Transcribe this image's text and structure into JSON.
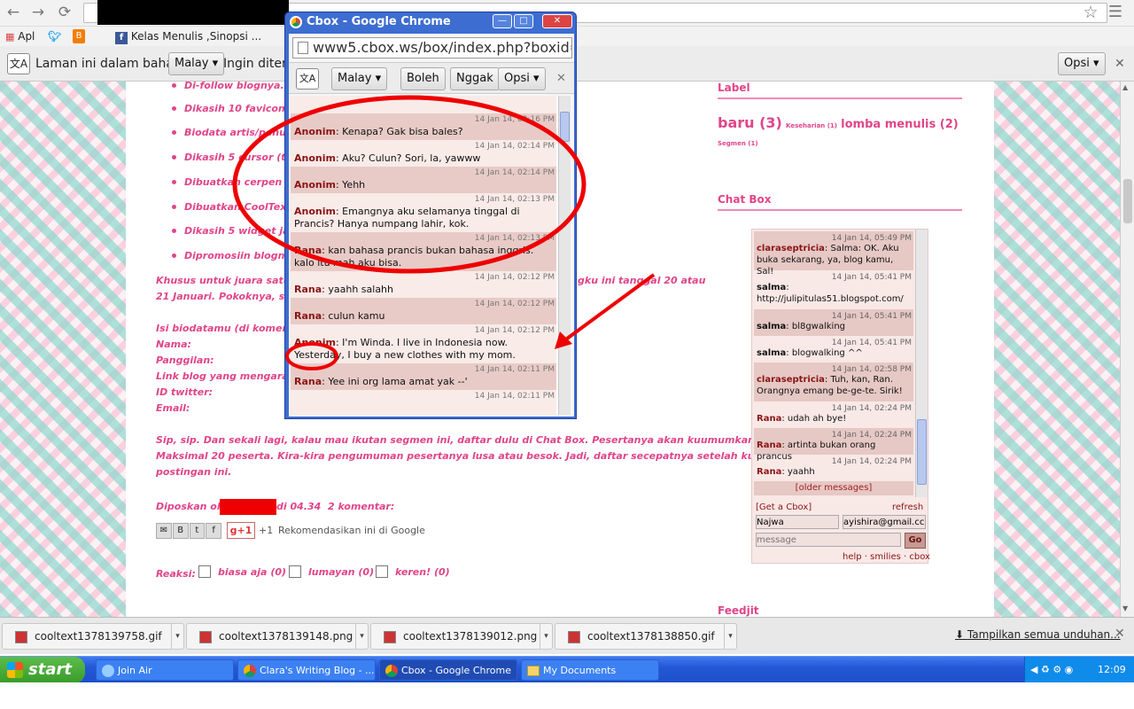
{
  "browser": {
    "bookmarks": [
      "Apl",
      "Kelas Menulis ,Sinopsi ..."
    ],
    "star_icon": "star-icon"
  },
  "translate_bar": {
    "text1": "Laman ini dalam bahasa",
    "language": "Malay",
    "text2": "Ingin diterje",
    "options": "Opsi"
  },
  "blog": {
    "bullets": [
      "Di-follow blognya.",
      "Dikasih 10 favicon (ter",
      "Biodata artis/penulis y",
      "Dikasih 5 cursor (terse",
      "Dibuatkan cerpen yang",
      "Dibuatkan CoolText de",
      "Dikasih 5 widget jam c",
      "Dipromosiin blognya d"
    ],
    "para1_line1": "Khusus untuk juara satu, bole",
    "para1_line1_right": "gku ini tanggal 20 atau",
    "para1_line2": "21 Januari. Pokoknya, secepa",
    "form_title": "Isi biodatamu (di komentar):",
    "form_fields": [
      "Nama:",
      "Panggilan:",
      "Link blog yang mengarag ke",
      "ID twitter:",
      "Email:"
    ],
    "para2_line1": "Sip, sip. Dan sekali lagi, kalau mau ikutan segmen ini, daftar dulu di Chat Box. Pesertanya akan kuumumkan nanti.",
    "para2_line2": "Maksimal 20 peserta. Kira-kira pengumuman pesertanya lusa atau besok. Jadi, daftar secepatnya setelah ku-post",
    "para2_line3": "postingan ini.",
    "posted_by": "Diposkan oleh",
    "posted_time": "di 04.34",
    "comments": "2 komentar:",
    "gplus_count": "+1",
    "recommend": "Rekomendasikan ini di Google",
    "reactions_label": "Reaksi:",
    "reactions": [
      "biasa aja (0)",
      "lumayan (0)",
      "keren! (0)"
    ]
  },
  "sidebar": {
    "label_title": "Label",
    "labels": [
      {
        "text": "baru (3)",
        "size": "big"
      },
      {
        "text": "Keseharian (1)",
        "size": "small"
      },
      {
        "text": "lomba menulis (2)",
        "size": "big"
      },
      {
        "text": "Segmen (1)",
        "size": "small"
      }
    ],
    "chatbox_title": "Chat Box",
    "feedjit_title": "Feedjit"
  },
  "side_chat": {
    "messages": [
      {
        "ts": "14 Jan 14, 05:49 PM",
        "name": "claraseptricia",
        "text": ": Salma: OK. Aku buka sekarang, ya, blog kamu, Sal!",
        "alt": true
      },
      {
        "ts": "14 Jan 14, 05:41 PM",
        "name": "salma",
        "text": ":",
        "link": "http://julipitulas51.blogspot.com/",
        "alt": false
      },
      {
        "ts": "14 Jan 14, 05:41 PM",
        "name": "salma",
        "text": ": bl8gwalking",
        "alt": true
      },
      {
        "ts": "14 Jan 14, 05:41 PM",
        "name": "salma",
        "text": ": blogwalking ^^",
        "alt": false
      },
      {
        "ts": "14 Jan 14, 02:58 PM",
        "name": "claraseptricia",
        "text": ": Tuh, kan, Ran. Orangnya emang be-ge-te. Sirik!",
        "alt": true
      },
      {
        "ts": "14 Jan 14, 02:24 PM",
        "name": "Rana",
        "text": ": udah ah bye!",
        "alt": false
      },
      {
        "ts": "14 Jan 14, 02:24 PM",
        "name": "Rana",
        "text": ": artinta bukan orang prancus",
        "alt": true
      },
      {
        "ts": "14 Jan 14, 02:24 PM",
        "name": "Rana",
        "text": ": yaahh",
        "alt": false
      }
    ],
    "older": "[older messages]",
    "get_cbox": "[Get a Cbox]",
    "refresh": "refresh",
    "name_value": "Najwa",
    "email_value": "ayishira@gmail.cc",
    "message_placeholder": "message",
    "go": "Go",
    "footer_links": [
      "help",
      "smilies",
      "cbox"
    ]
  },
  "popup": {
    "title": "Cbox - Google Chrome",
    "url": "www5.cbox.ws/box/index.php?boxid=82",
    "language": "Malay",
    "yes": "Boleh",
    "no": "Nggak",
    "options": "Opsi",
    "messages": [
      {
        "ts": "14 Jan 14, 02:16 PM",
        "name": "Anonim",
        "text": ": Kenapa? Gak bisa bales?",
        "style": "alt"
      },
      {
        "ts": "14 Jan 14, 02:14 PM",
        "name": "Anonim",
        "text": ": Aku? Culun? Sori, la, yawww",
        "style": "light"
      },
      {
        "ts": "14 Jan 14, 02:14 PM",
        "name": "Anonim",
        "text": ": Yehh",
        "style": "alt"
      },
      {
        "ts": "14 Jan 14, 02:13 PM",
        "name": "Anonim",
        "text": ": Emangnya aku selamanya tinggal di Prancis? Hanya numpang lahir, kok.",
        "style": "light"
      },
      {
        "ts": "14 Jan 14, 02:13 PM",
        "name": "Rana",
        "text": ": kan bahasa prancis bukan bahasa inggris. kalo itu mah aku bisa.",
        "style": "alt"
      },
      {
        "ts": "14 Jan 14, 02:12 PM",
        "name": "Rana",
        "text": ": yaahh salahh",
        "style": "light"
      },
      {
        "ts": "14 Jan 14, 02:12 PM",
        "name": "Rana",
        "text": ": culun kamu",
        "style": "alt"
      },
      {
        "ts": "14 Jan 14, 02:12 PM",
        "name": "Anonim",
        "text": ": I'm Winda. I live in Indonesia now. Yesterday, I buy a new clothes with my mom.",
        "style": "light"
      },
      {
        "ts": "14 Jan 14, 02:11 PM",
        "name": "Rana",
        "text": ": Yee ini org lama amat yak --'",
        "style": "alt"
      },
      {
        "ts": "14 Jan 14, 02:11 PM",
        "name": "",
        "text": "",
        "style": "light"
      }
    ]
  },
  "downloads": {
    "files": [
      "cooltext1378139758.gif",
      "cooltext1378139148.png",
      "cooltext1378139012.png",
      "cooltext1378138850.gif"
    ],
    "show_all": "Tampilkan semua unduhan..."
  },
  "taskbar": {
    "start": "start",
    "tasks": [
      {
        "label": "Join Air",
        "active": false
      },
      {
        "label": "Clara's Writing Blog - ...",
        "active": false
      },
      {
        "label": "Cbox - Google Chrome",
        "active": true
      },
      {
        "label": "My Documents",
        "active": false
      }
    ],
    "clock": "12:09"
  }
}
